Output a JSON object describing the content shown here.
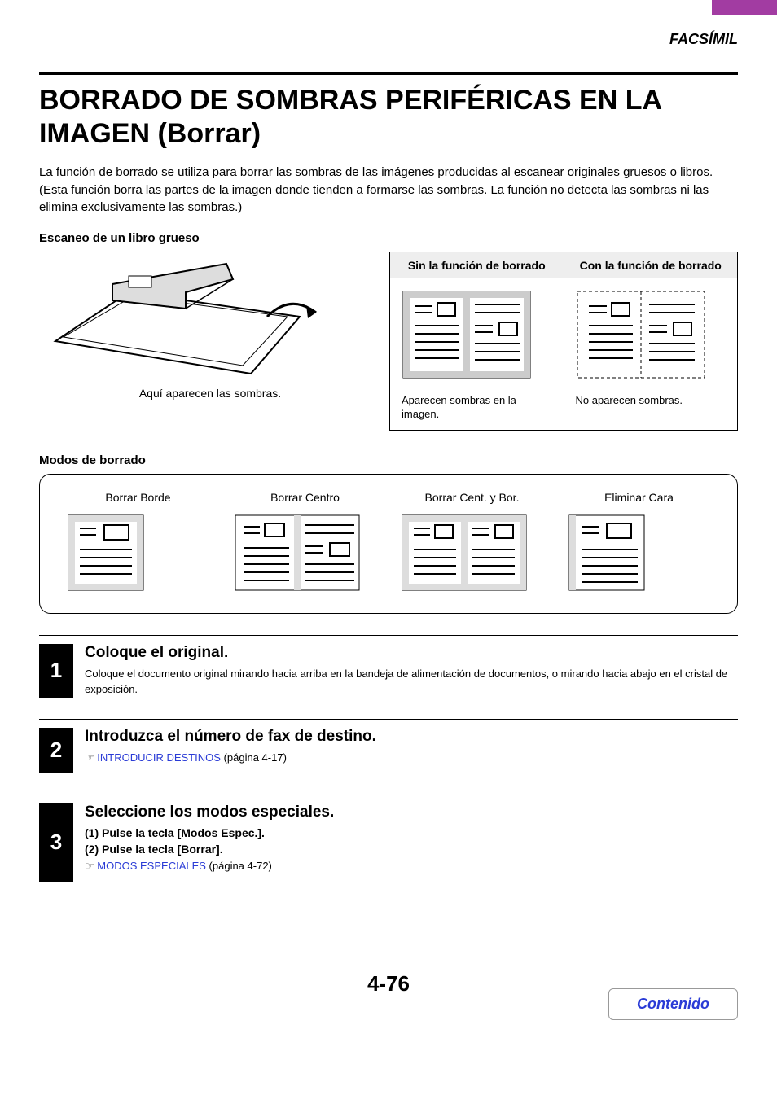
{
  "header": {
    "section_label": "FACSÍMIL"
  },
  "title": "BORRADO DE SOMBRAS PERIFÉRICAS EN LA IMAGEN (Borrar)",
  "intro": "La función de borrado se utiliza para borrar las sombras de las imágenes producidas al escanear originales gruesos o libros. (Esta función borra las partes de la imagen donde tienden a formarse las sombras. La función no detecta las sombras ni las elimina exclusivamente las sombras.)",
  "scan_subhead": "Escaneo de un libro grueso",
  "scan_caption": "Aquí aparecen las sombras.",
  "compare": {
    "without": {
      "head": "Sin la función de borrado",
      "note": "Aparecen sombras en la imagen."
    },
    "with": {
      "head": "Con la función de borrado",
      "note": "No aparecen sombras."
    }
  },
  "modes_subhead": "Modos de borrado",
  "modes": {
    "edge": "Borrar Borde",
    "center": "Borrar Centro",
    "edge_center": "Borrar Cent. y Bor.",
    "side": "Eliminar Cara"
  },
  "steps": {
    "s1": {
      "num": "1",
      "title": "Coloque el original.",
      "text": "Coloque el documento original mirando hacia arriba en la bandeja de alimentación de documentos, o mirando hacia abajo en el cristal de exposición."
    },
    "s2": {
      "num": "2",
      "title": "Introduzca el número de fax de destino.",
      "link_text": "INTRODUCIR DESTINOS",
      "link_suffix": " (página 4-17)"
    },
    "s3": {
      "num": "3",
      "title": "Seleccione los modos especiales.",
      "sub1": "(1)  Pulse la tecla [Modos Espec.].",
      "sub2": "(2)  Pulse la tecla [Borrar].",
      "link_text": "MODOS ESPECIALES",
      "link_suffix": " (página 4-72)"
    }
  },
  "page_number": "4-76",
  "toc_label": "Contenido",
  "pointer_glyph": "☞"
}
